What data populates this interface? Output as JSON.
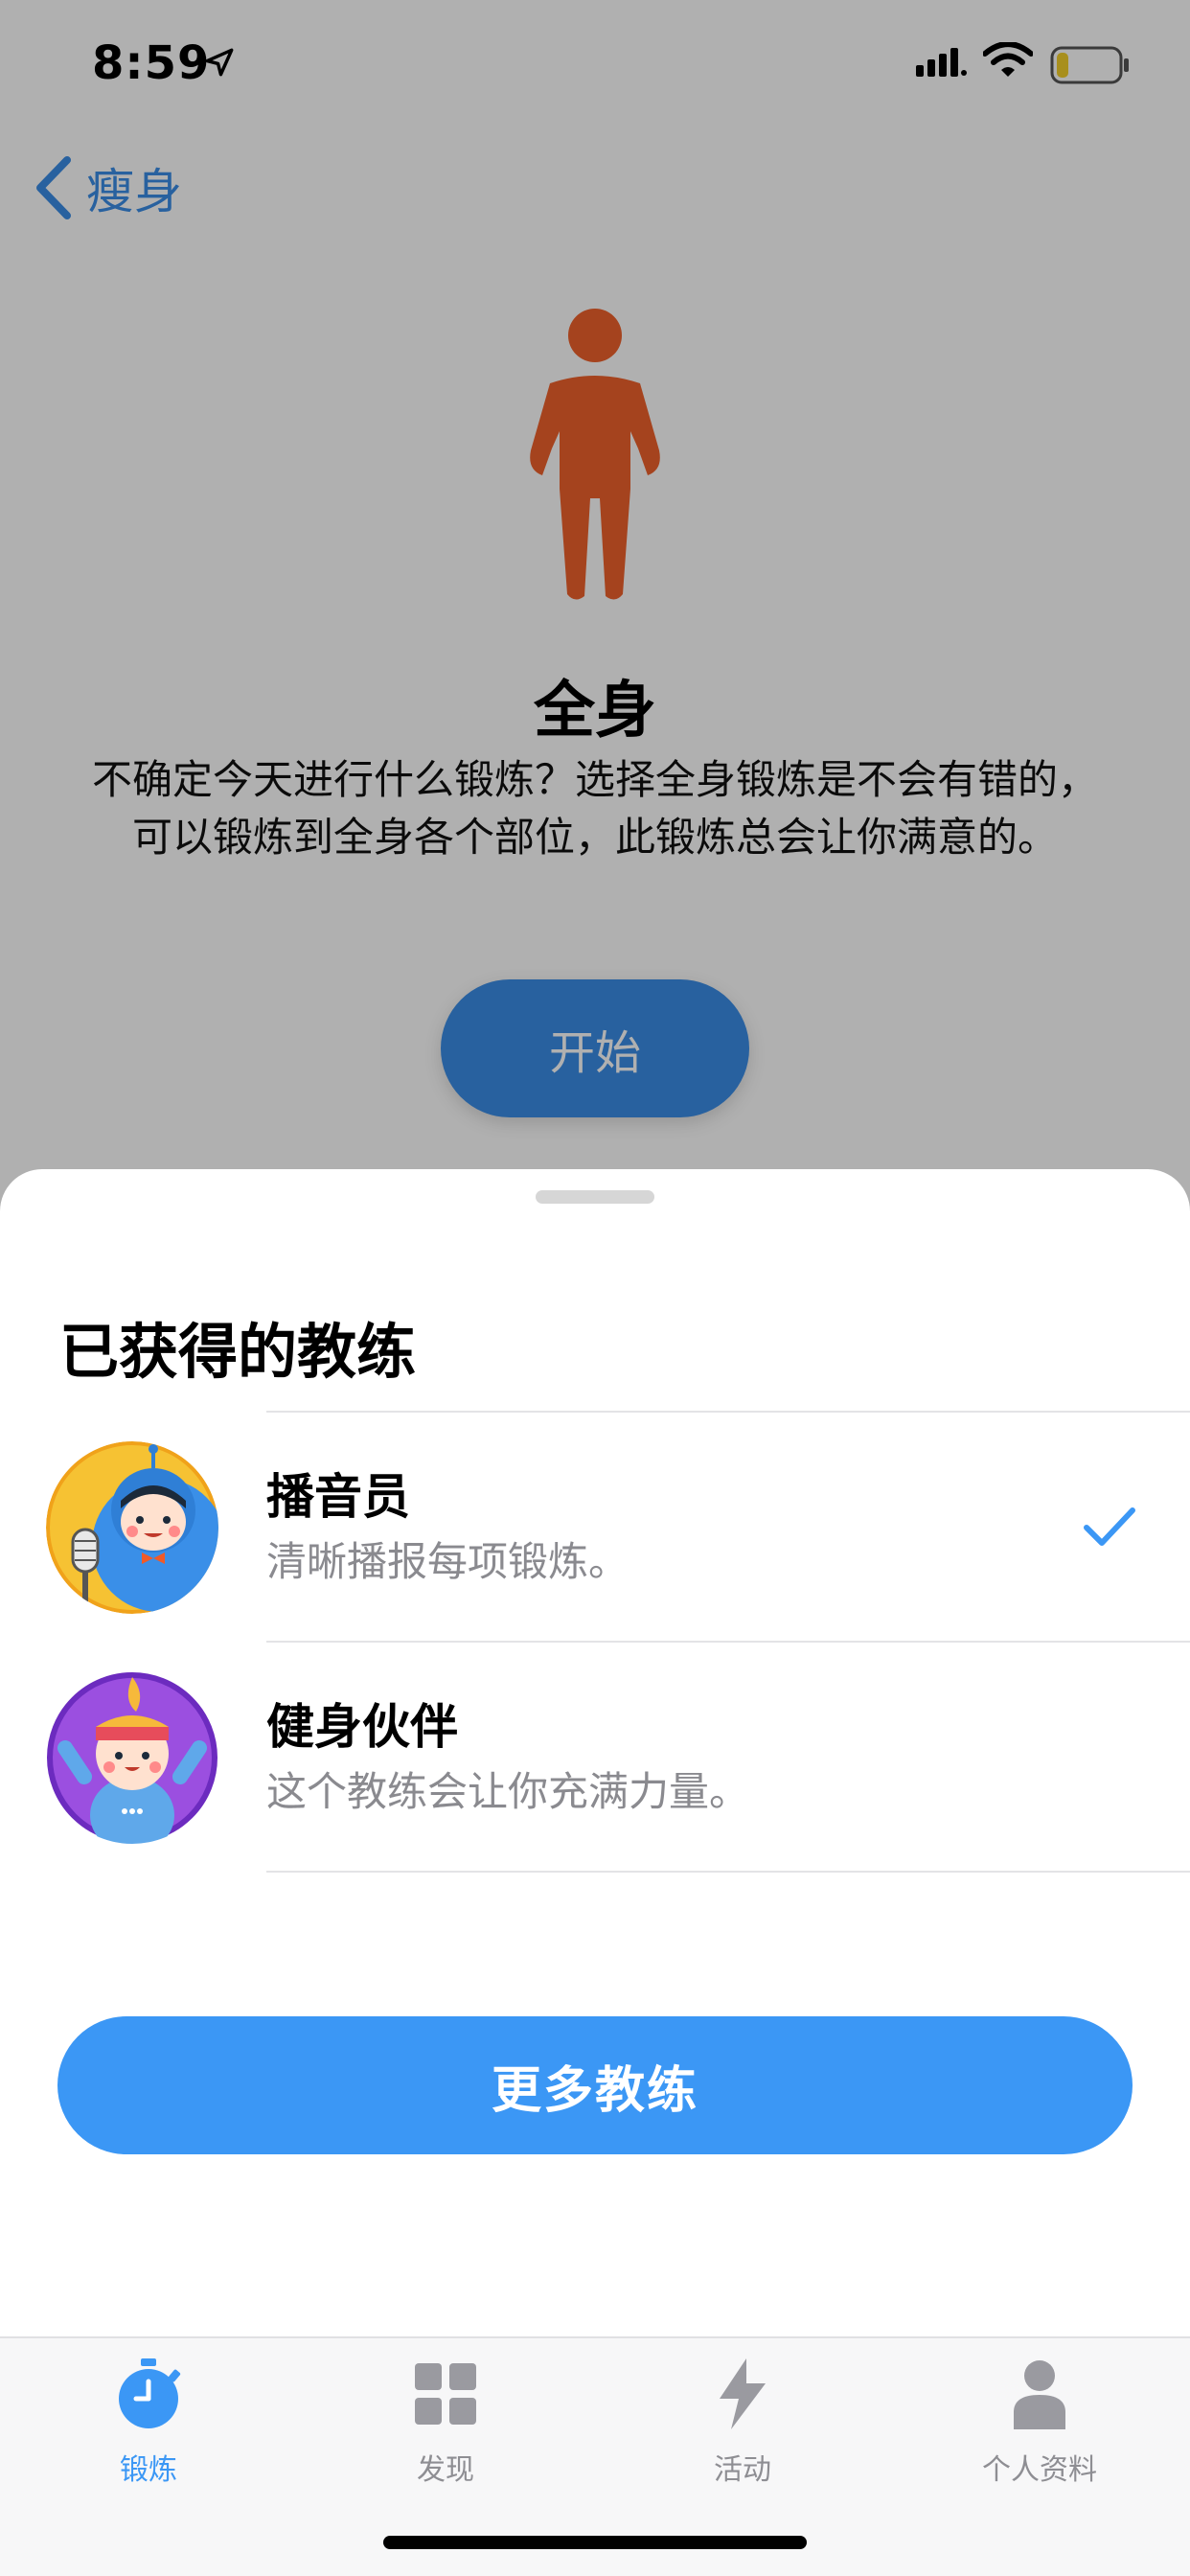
{
  "status_bar": {
    "time": "8:59",
    "icons": [
      "location-arrow-icon",
      "cellular-signal-icon",
      "wifi-icon",
      "battery-low-icon"
    ]
  },
  "nav": {
    "back_label": "瘦身",
    "back_icon": "chevron-left-icon"
  },
  "hero": {
    "figure_icon": "standing-person-icon",
    "title": "全身",
    "description": "不确定今天进行什么锻炼？选择全身锻炼是不会有错的，可以锻炼到全身各个部位，此锻炼总会让你满意的。",
    "start_label": "开始"
  },
  "sheet": {
    "title": "已获得的教练",
    "coaches": [
      {
        "name": "播音员",
        "subtitle": "清晰播报每项锻炼。",
        "avatar": "announcer-avatar",
        "selected": true
      },
      {
        "name": "健身伙伴",
        "subtitle": "这个教练会让你充满力量。",
        "avatar": "fitness-buddy-avatar",
        "selected": false
      }
    ],
    "more_label": "更多教练"
  },
  "tabs": [
    {
      "label": "锻炼",
      "icon": "stopwatch-icon",
      "active": true
    },
    {
      "label": "发现",
      "icon": "grid-icon",
      "active": false
    },
    {
      "label": "活动",
      "icon": "lightning-icon",
      "active": false
    },
    {
      "label": "个人资料",
      "icon": "person-icon",
      "active": false
    }
  ],
  "colors": {
    "accent": "#3b97f5",
    "figure": "#e05a2b",
    "check": "#3b97f5"
  }
}
